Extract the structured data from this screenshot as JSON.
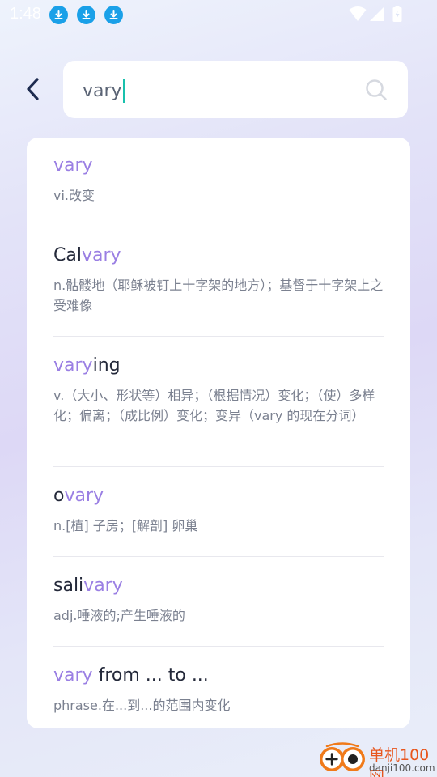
{
  "status_bar": {
    "time": "1:48",
    "download_icons": [
      "download-icon",
      "download-icon",
      "download-icon"
    ],
    "system_icons": [
      "wifi-icon",
      "signal-icon",
      "battery-icon"
    ]
  },
  "search": {
    "query": "vary"
  },
  "results": [
    {
      "word_prefix": "",
      "word_match": "vary",
      "word_suffix": "",
      "definition": "vi.改变"
    },
    {
      "word_prefix": "Cal",
      "word_match": "vary",
      "word_suffix": "",
      "definition": "n.骷髅地（耶稣被钉上十字架的地方）；基督于十字架上之受难像"
    },
    {
      "word_prefix": "",
      "word_match": "vary",
      "word_suffix": "ing",
      "definition": "v.（大小、形状等）相异；（根据情况）变化；（使）多样化；偏离；（成比例）变化；变异（vary 的现在分词）"
    },
    {
      "word_prefix": "o",
      "word_match": "vary",
      "word_suffix": "",
      "definition": "n.[植] 子房；[解剖] 卵巢"
    },
    {
      "word_prefix": "sali",
      "word_match": "vary",
      "word_suffix": "",
      "definition": "adj.唾液的;产生唾液的"
    },
    {
      "word_prefix": "",
      "word_match": "vary",
      "word_suffix": " from ... to ...",
      "definition": "phrase.在...到...的范围内变化"
    }
  ],
  "watermark": {
    "cn": "单机100网",
    "en": "danji100.com"
  },
  "colors": {
    "highlight": "#9a7fe3",
    "caret": "#19c1ad",
    "download_icon": "#1aa0e8"
  }
}
